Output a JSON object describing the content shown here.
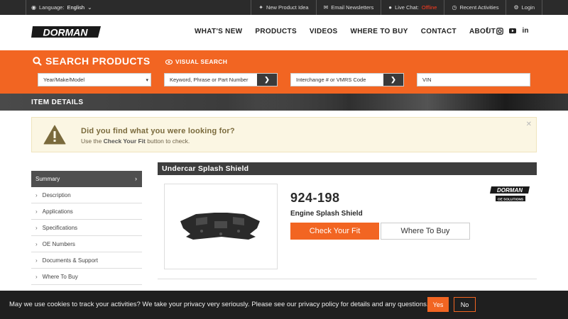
{
  "topbar": {
    "language_label": "Language:",
    "language_value": "English",
    "items": [
      {
        "icon": "lightbulb-icon",
        "label": "New Product Idea"
      },
      {
        "icon": "envelope-icon",
        "label": "Email Newsletters"
      },
      {
        "icon": "chat-icon",
        "label": "Live Chat:",
        "status": "Offline"
      },
      {
        "icon": "history-icon",
        "label": "Recent Activities"
      },
      {
        "icon": "gear-icon",
        "label": "Login"
      }
    ]
  },
  "header": {
    "logo_text": "DORMAN",
    "nav": [
      "WHAT'S NEW",
      "PRODUCTS",
      "VIDEOS",
      "WHERE TO BUY",
      "CONTACT",
      "ABOUT"
    ],
    "social": [
      "facebook-icon",
      "instagram-icon",
      "youtube-icon",
      "linkedin-icon"
    ]
  },
  "search": {
    "title": "SEARCH PRODUCTS",
    "visual_search": "VISUAL SEARCH",
    "ymm_placeholder": "Year/Make/Model",
    "keyword_placeholder": "Keyword, Phrase or Part Number",
    "interchange_placeholder": "Interchange # or VMRS Code",
    "vin_placeholder": "VIN"
  },
  "section_band": "ITEM DETAILS",
  "alert": {
    "question": "Did you find what you were looking for?",
    "hint_prefix": "Use the",
    "hint_bold": "Check Your Fit",
    "hint_suffix": "button to check."
  },
  "sidebar": {
    "items": [
      "Summary",
      "Description",
      "Applications",
      "Specifications",
      "OE Numbers",
      "Documents & Support",
      "Where To Buy"
    ],
    "active": "Summary"
  },
  "product": {
    "title": "Undercar Splash Shield",
    "part_number": "924-198",
    "name": "Engine Splash Shield",
    "check_fit": "Check Your Fit",
    "where_to_buy": "Where To Buy",
    "brand_top": "DORMAN",
    "brand_bottom": "OE SOLUTIONS"
  },
  "cookie": {
    "message": "May we use cookies to track your activities? We take your privacy very seriously. Please see our privacy policy for details and any questions.",
    "yes": "Yes",
    "no": "No"
  },
  "colors": {
    "accent": "#f26522",
    "dark": "#3d3d3d",
    "alert_bg": "#fbf6e3"
  }
}
